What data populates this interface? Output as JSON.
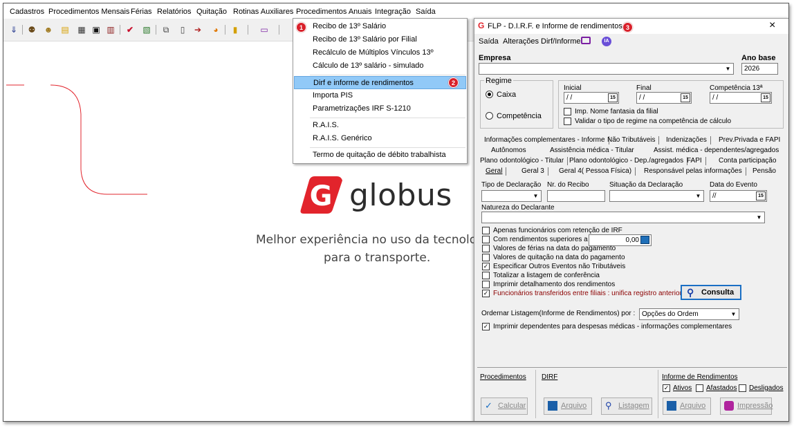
{
  "menubar": [
    "Cadastros",
    "Procedimentos Mensais",
    "Férias",
    "Relatórios",
    "Quitação",
    "Rotinas Auxiliares",
    "Procedimentos Anuais",
    "Integração",
    "Saída"
  ],
  "brand": {
    "name": "globus",
    "logo_letter": "G",
    "tagline_1": "Melhor experiência no uso da tecnolo",
    "tagline_2": "para o transporte.",
    "red": "#e2242c"
  },
  "dropdown": {
    "items": [
      "Recibo de 13º Salário",
      "Recibo de 13º Salário por Filial",
      "Recálculo de Múltiplos Vínculos 13º",
      "Cálculo de 13º salário - simulado",
      "Dirf e informe de rendimentos",
      "Importa PIS",
      "Parametrizações IRF S-1210",
      "R.A.I.S.",
      "R.A.I.S. Genérico",
      "Termo de quitação de débito trabalhista"
    ],
    "highlighted": "Dirf e informe de rendimentos",
    "badges": [
      "1",
      "2",
      "3"
    ]
  },
  "dialog": {
    "title": "FLP - D.I.R.F. e Informe de rendimentos",
    "close": "×",
    "menu": [
      "Saída",
      "Alterações Dirf/Informe"
    ],
    "ia_label": "IA",
    "empresa_label": "Empresa",
    "ano_base_label": "Ano base",
    "ano_base_value": "2026",
    "regime_label": "Regime",
    "regime_options": [
      "Caixa",
      "Competência"
    ],
    "inicial_label": "Inicial",
    "final_label": "Final",
    "competencia13_label": "Competência 13ª",
    "date_empty": "/ /",
    "date_empty_tight": "//",
    "cal_glyph": "15",
    "imp_nome_fantasia": "Imp. Nome fantasia da filial",
    "validar_regime": "Validar o tipo de regime na competência de cálculo",
    "tabs_row1": [
      "Informações complementares - Informe",
      "Não Tributáveis",
      "Indenizações",
      "Prev.Privada e FAPI"
    ],
    "tabs_row2": [
      "Autônomos",
      "Assistência médica - Titular",
      "Assist. médica - dependentes/agregados"
    ],
    "tabs_row3": [
      "Plano odontológico - Titular",
      "Plano odontológico - Dep./agregados",
      "FAPI",
      "Conta participação"
    ],
    "tabs_row4": [
      "Geral",
      "Geral 3",
      "Geral 4( Pessoa Física)",
      "Responsável pelas informações",
      "Pensão"
    ],
    "tipo_declaracao_label": "Tipo de Declaração",
    "nro_recibo_label": "Nr. do Recibo",
    "situacao_label": "Situação da Declaração",
    "data_evento_label": "Data do Evento",
    "natureza_label": "Natureza do Declarante",
    "checks": [
      {
        "label": "Apenas funcionários com retenção de IRF",
        "checked": false
      },
      {
        "label": "Com rendimentos superiores a",
        "checked": false
      },
      {
        "label": "Valores de férias na data do pagamento",
        "checked": false
      },
      {
        "label": "Valores de quitação na data do pagamento",
        "checked": false
      },
      {
        "label": "Especificar Outros Eventos não Tributáveis",
        "checked": true
      },
      {
        "label": "Totalizar a listagem de conferência",
        "checked": false
      },
      {
        "label": "Imprimir detalhamento dos rendimentos",
        "checked": false
      },
      {
        "label": "Funcionários transferidos entre filiais : unifica registro anterior",
        "checked": true
      }
    ],
    "rendimentos_value": "0,00",
    "consulta_label": "Consulta",
    "ordenar_label": "Ordernar Listagem(Informe de Rendimentos) por :",
    "ordenar_value": "Opções do Ordem",
    "imprimir_dependentes": "Imprimir dependentes para despesas médicas - informações complementares",
    "procedimentos_label": "Procedimentos",
    "dirf_label": "DIRF",
    "informe_label": "Informe de Rendimentos",
    "status_checks": [
      {
        "label": "Ativos",
        "checked": true
      },
      {
        "label": "Afastados",
        "checked": false
      },
      {
        "label": "Desligados",
        "checked": false
      }
    ],
    "buttons": [
      "Calcular",
      "Arquivo",
      "Listagem",
      "Arquivo",
      "Impressão"
    ]
  }
}
